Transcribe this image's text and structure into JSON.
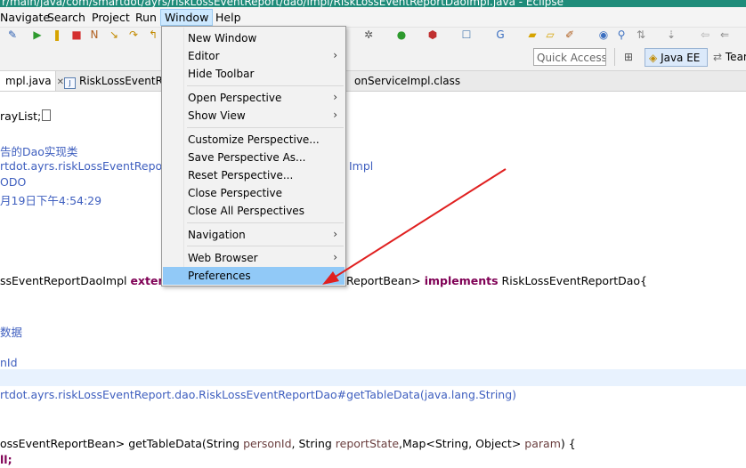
{
  "window": {
    "title": "r/main/java/com/smartdot/ayrs/riskLossEventReport/dao/impl/RiskLossEventReportDaoImpl.java - Eclipse"
  },
  "menubar": {
    "items": [
      "Navigate",
      "Search",
      "Project",
      "Run",
      "Window",
      "Help"
    ],
    "active": "Window"
  },
  "toolbar": {
    "quick_access_placeholder": "Quick Access",
    "perspectives": [
      "Java EE",
      "Team"
    ]
  },
  "tabs": [
    {
      "label": "mpl.java",
      "close": "✕"
    },
    {
      "label": "RiskLossEventRep"
    },
    {
      "label": "onServiceImpl.class"
    }
  ],
  "window_menu": {
    "items": [
      {
        "label": "New Window",
        "submenu": false
      },
      {
        "label": "Editor",
        "submenu": true
      },
      {
        "label": "Hide Toolbar",
        "submenu": false
      },
      {
        "label": "Open Perspective",
        "submenu": true
      },
      {
        "label": "Show View",
        "submenu": true
      },
      {
        "label": "Customize Perspective...",
        "submenu": false
      },
      {
        "label": "Save Perspective As...",
        "submenu": false
      },
      {
        "label": "Reset Perspective...",
        "submenu": false
      },
      {
        "label": "Close Perspective",
        "submenu": false
      },
      {
        "label": "Close All Perspectives",
        "submenu": false
      },
      {
        "label": "Navigation",
        "submenu": true
      },
      {
        "label": "Web Browser",
        "submenu": true
      },
      {
        "label": "Preferences",
        "submenu": false,
        "highlighted": true
      }
    ]
  },
  "code": {
    "l1": "rayList;",
    "l2": "告的Dao实现类",
    "l3a": "rtdot.ayrs.riskLossEventReport",
    "l3b": "Impl",
    "l4": "ODO",
    "l5": "月19日下午4:54:29",
    "l6a": "ssEventReportDaoImpl ",
    "l6kw": "exten",
    "l6b": "ReportBean> ",
    "l6kw2": "implements",
    "l6c": " RiskLossEventReportDao{",
    "l7": "数据",
    "l8": "nId",
    "l9": "rtdot.ayrs.riskLossEventReport.dao.RiskLossEventReportDao#getTableData(java.lang.String)",
    "l10a": "ossEventReportBean> getTableData(String ",
    "l10p1": "personId",
    "l10b": ", String ",
    "l10p2": "reportState",
    "l10c": ",Map<String, Object> ",
    "l10p3": "param",
    "l10d": ") {",
    "l11": "ll;"
  },
  "colors": {
    "titlebar": "#1f8c7a",
    "menu_highlight": "#91c9f7",
    "annotation_arrow": "#e02020",
    "comment": "#3f5fbf",
    "keyword": "#7f0055"
  }
}
